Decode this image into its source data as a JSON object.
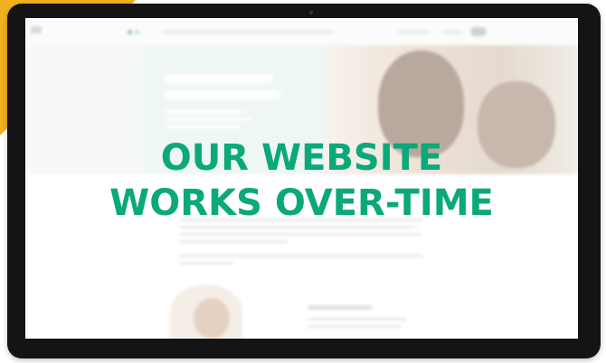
{
  "overlay": {
    "line1": "OUR WEBSITE",
    "line2": "WORKS OVER-TIME"
  },
  "colors": {
    "accent": "#0ba87a",
    "corner_accent": "#f2b21f",
    "device_frame": "#141414"
  },
  "icons": [
    "camera-icon"
  ]
}
